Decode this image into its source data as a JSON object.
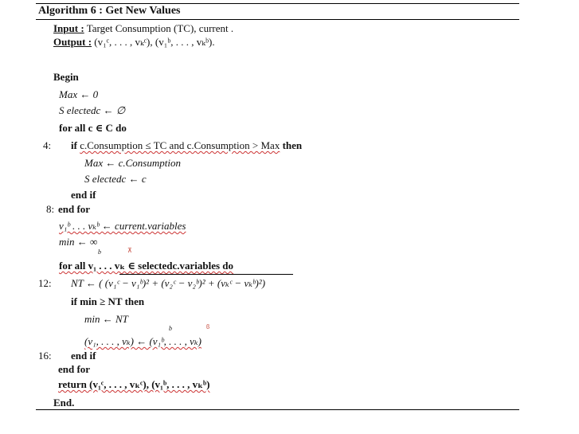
{
  "title": "Algorithm 6 : Get New Values",
  "input": {
    "label": "Input :",
    "text": "Target Consumption (TC), current ."
  },
  "output": {
    "label": "Output :",
    "text": "(v₁ᶜ, . . . , vₖᶜ), (v₁ᵇ, . . . , vₖᵇ)."
  },
  "lines": {
    "begin": "Begin",
    "max_init": "Max ← 0",
    "selected_init": "S electedc ← ∅",
    "for_c": "for all c ∈ C do",
    "if_cons_pre": "if",
    "if_cons_mid": "c.Consumption ≤ TC and c.Consumption > Max",
    "if_cons_then": "then",
    "max_assign": "Max ← c.Consumption",
    "sel_assign": "S electedc ← c",
    "end_if_1": "end if",
    "end_for_1": "end for",
    "vars_assign": "v₁ᵇ . . . vₖᵇ ← current.variables",
    "min_init": "min ← ∞",
    "for_vars": "for all v₁ . . . vₖ ∈ selectedc.variables do",
    "nt_assign": "NT ← ( (v₁ᶜ − v₁ᵇ)² + (v₂ᶜ − v₂ᵇ)² + (vₖᶜ − vₖᵇ)²)",
    "if_min": "if min ≥ NT then",
    "min_assign": "min ← NT",
    "tuple_assign": "(v₁, . . . , vₖ) ← (v₁ᵇ, . . . , vₖ)",
    "end_if_2": "end if",
    "end_for_2": "end for",
    "return": "return (v₁ᶜ, . . . , vₖᶜ), (v₁ᵇ, . . . , vₖᵇ)",
    "end": "End."
  },
  "line_numbers": [
    "4:",
    "8:",
    "12:",
    "16:"
  ]
}
